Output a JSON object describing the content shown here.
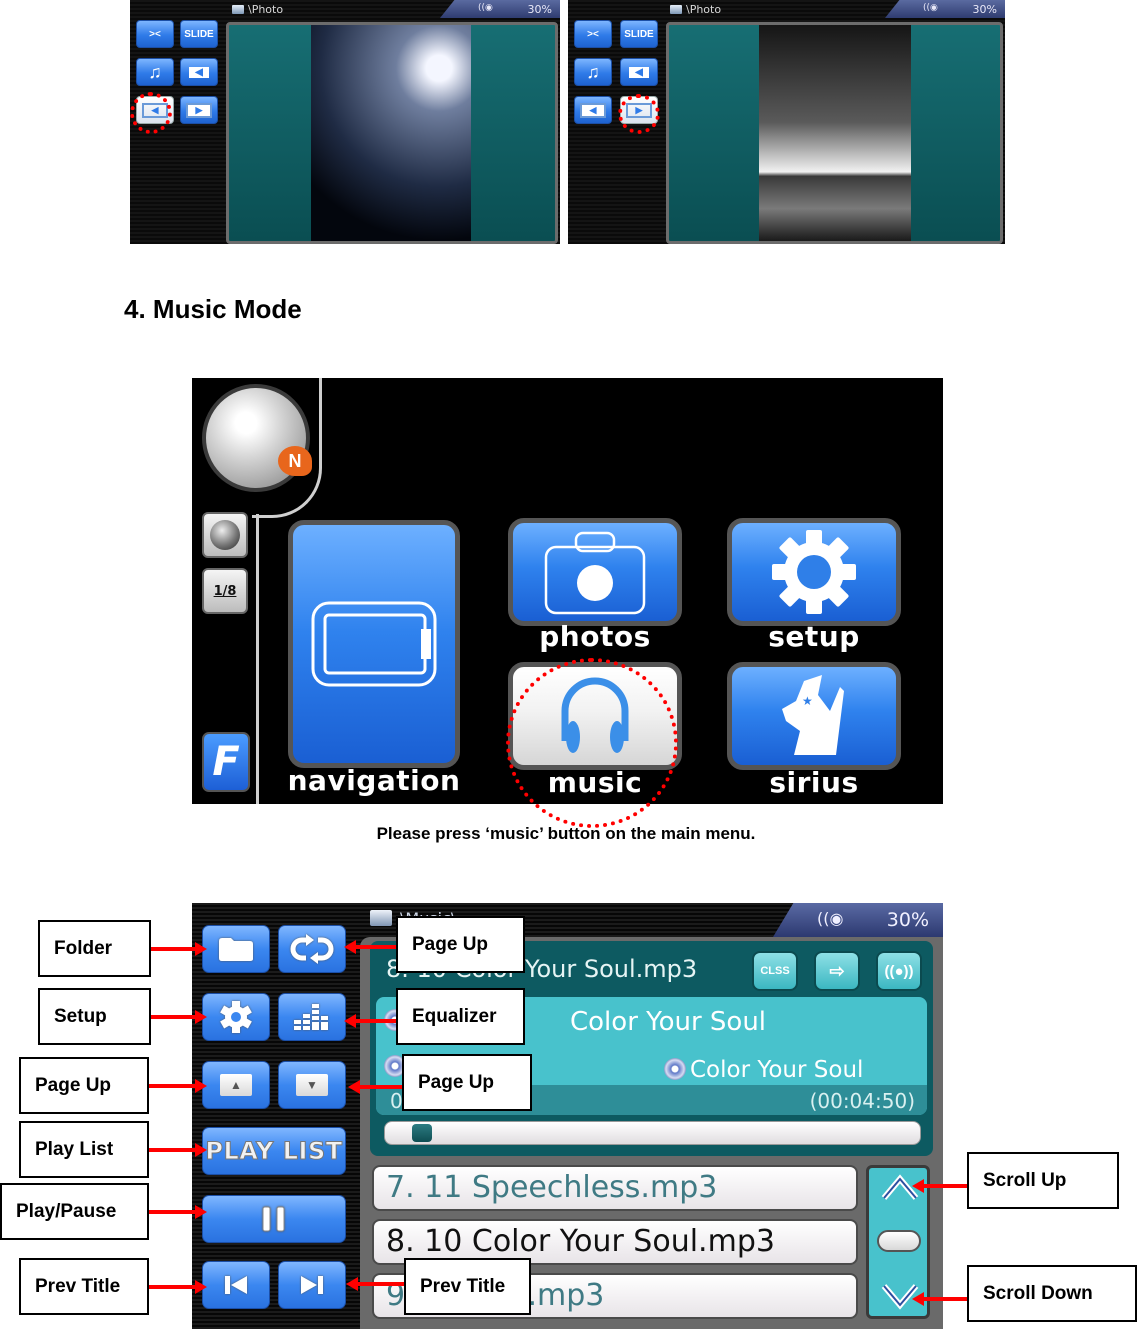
{
  "photo_screens": [
    {
      "path": "\\Photo",
      "battery": "30%",
      "buttons": {
        "fit": "fit-icon",
        "slide": "SLIDE",
        "music": "music-note-icon",
        "folder_back": "folder-back-icon",
        "prev": "prev-photo-icon",
        "next": "next-photo-icon"
      },
      "highlighted": "prev",
      "photo": "night tree with moon"
    },
    {
      "path": "\\Photo",
      "battery": "30%",
      "buttons": {
        "fit": "fit-icon",
        "slide": "SLIDE",
        "music": "music-note-icon",
        "folder_back": "folder-back-icon",
        "prev": "prev-photo-icon",
        "next": "next-photo-icon"
      },
      "highlighted": "next",
      "photo": "black and white figure on rocky shore"
    }
  ],
  "section": {
    "title": "4. Music Mode"
  },
  "main_menu": {
    "compass_label": "N",
    "scale_label": "1/8",
    "logo_letter": "F",
    "tiles": {
      "navigation": "navigation",
      "photos": "photos",
      "setup": "setup",
      "music": "music",
      "sirius": "sirius"
    },
    "caption": "Please press ‘music’ button on the main menu."
  },
  "music_screen": {
    "path": "\\Music\\...",
    "battery": "30%",
    "now_playing_file": "8. 10 Color Your Soul.mp3",
    "mode_buttons": [
      "CLSS",
      "shuffle-icon",
      "srs-icon"
    ],
    "song_title": "Color Your Soul",
    "album": "Color Your Soul",
    "elapsed": "0",
    "duration": "(00:04:50)",
    "progress_fraction": 0.03,
    "left_buttons": {
      "play_list": "PLAY LIST"
    },
    "playlist": [
      {
        "label": "7. 11 Speechless.mp3",
        "current": false
      },
      {
        "label": "8. 10 Color Your Soul.mp3",
        "current": true
      },
      {
        "label": "9. ... Falls.mp3",
        "current": false
      }
    ]
  },
  "callouts": {
    "folder": "Folder",
    "setup": "Setup",
    "page_up_left": "Page Up",
    "play_list": "Play List",
    "play_pause": "Play/Pause",
    "prev_title_left": "Prev Title",
    "repeat": "Page Up",
    "equalizer": "Equalizer",
    "page_down": "Page Up",
    "next_title": "Prev Title",
    "scroll_up": "Scroll Up",
    "scroll_down": "Scroll Down"
  },
  "colors": {
    "accent_blue": "#2f82ee",
    "teal": "#48c2cc",
    "annotation_red": "#ff0000"
  }
}
